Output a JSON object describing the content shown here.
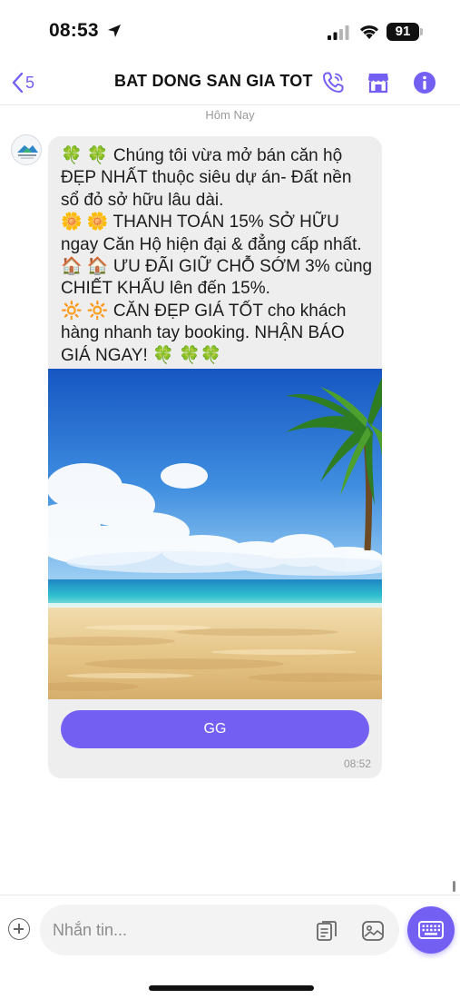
{
  "status_bar": {
    "time": "08:53",
    "battery": "91"
  },
  "header": {
    "back_count": "5",
    "title": "BAT DONG SAN GIA TOT"
  },
  "date_separator": "Hôm Nay",
  "message": {
    "lines": [
      "🍀 🍀 Chúng tôi vừa mở bán căn hộ ĐẸP NHẤT thuộc siêu dự án- Đất nền sổ đỏ sở hữu lâu dài.",
      "🌼 🌼 THANH TOÁN 15%  SỞ HỮU ngay Căn Hộ hiện đại & đẳng cấp nhất. 🏠 🏠  ƯU ĐÃI GIỮ CHỖ SỚM 3% cùng CHIẾT KHẤU lên đến 15%.",
      "🔆 🔆   CĂN ĐẸP GIÁ TỐT cho khách hàng nhanh tay booking. NHẬN BÁO GIÁ NGAY! 🍀 🍀🍀"
    ],
    "button_label": "GG",
    "time": "08:52"
  },
  "composer": {
    "placeholder": "Nhắn tin..."
  },
  "colors": {
    "accent": "#7360f2",
    "bubble": "#eeeeef",
    "sky_top": "#1d62c9",
    "sea": "#2bb3c9",
    "sand": "#e3c58c"
  },
  "icons": {
    "back": "chevron-left-icon",
    "call": "phone-icon",
    "shop": "shop-icon",
    "info": "info-icon",
    "add": "plus-circle-icon",
    "sticker": "sticker-icon",
    "gallery": "gallery-icon",
    "keyboard": "keyboard-icon"
  }
}
